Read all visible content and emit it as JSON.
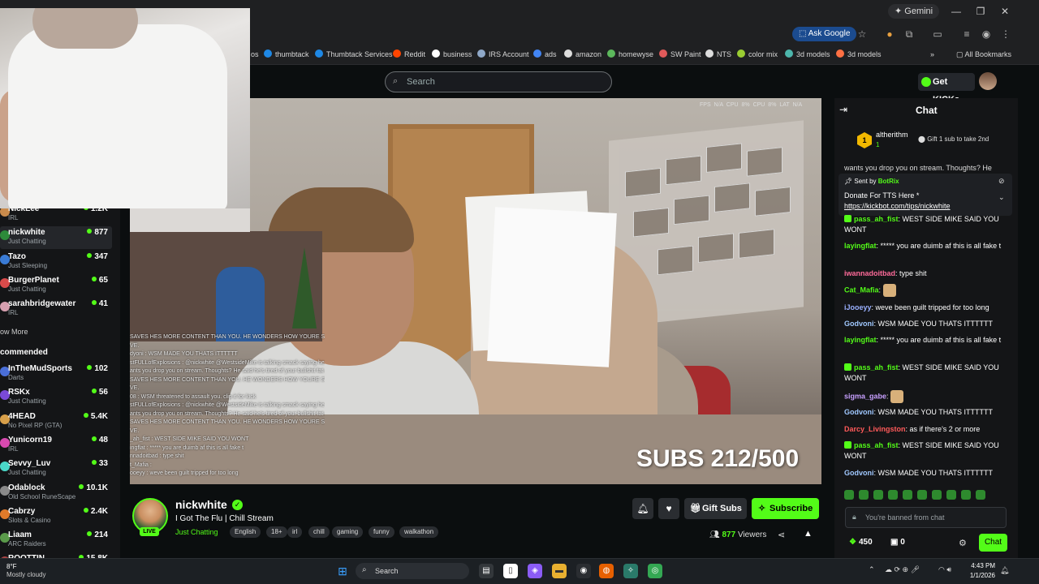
{
  "browser": {
    "gemini_label": "Gemini",
    "ask_google_label": "Ask Google",
    "all_bookmarks_label": "All Bookmarks",
    "bookmarks": [
      {
        "label": "thumbtack",
        "color": "#1e88e5"
      },
      {
        "label": "Thumbtack Services",
        "color": "#1e88e5"
      },
      {
        "label": "Reddit",
        "color": "#ff4500"
      },
      {
        "label": "business",
        "color": "#ffffff"
      },
      {
        "label": "IRS Account",
        "color": "#8fa8c8"
      },
      {
        "label": "ads",
        "color": "#4285f4"
      },
      {
        "label": "amazon",
        "color": "#dddddd"
      },
      {
        "label": "homewyse",
        "color": "#5cb85c"
      },
      {
        "label": "SW Paint",
        "color": "#e05a5a"
      },
      {
        "label": "NTS",
        "color": "#dddddd"
      },
      {
        "label": "color mix",
        "color": "#9acd32"
      },
      {
        "label": "3d models",
        "color": "#4db6ac"
      },
      {
        "label": "3d models",
        "color": "#ff7043"
      }
    ],
    "bookmark_partial": "os"
  },
  "kick": {
    "search_placeholder": "Search",
    "get_kicks_label": "Get KICKs",
    "brand_green": "#53fc18"
  },
  "sidebar": {
    "following": [
      {
        "name": "NickLee",
        "category": "IRL",
        "viewers": "1.2K",
        "color": "#c98b4c"
      },
      {
        "name": "nickwhite",
        "category": "Just Chatting",
        "viewers": "877",
        "color": "#2d8a3a"
      },
      {
        "name": "Tazo",
        "category": "Just Sleeping",
        "viewers": "347",
        "color": "#3a7bd5"
      },
      {
        "name": "BurgerPlanet",
        "category": "Just Chatting",
        "viewers": "65",
        "color": "#d84a4a"
      },
      {
        "name": "sarahbridgewater",
        "category": "IRL",
        "viewers": "41",
        "color": "#d6a0b0"
      }
    ],
    "show_more_label": "ow More",
    "recommended_label": "commended",
    "recommended": [
      {
        "name": "InTheMudSports",
        "category": "Darts",
        "viewers": "102",
        "color": "#4a6fd8"
      },
      {
        "name": "RSKx",
        "category": "Just Chatting",
        "viewers": "56",
        "color": "#7a4ad8"
      },
      {
        "name": "4HEAD",
        "category": "No Pixel RP (GTA)",
        "viewers": "5.4K",
        "color": "#d8a04a"
      },
      {
        "name": "Yunicorn19",
        "category": "IRL",
        "viewers": "48",
        "color": "#d84ab0"
      },
      {
        "name": "Sevvy_Luv",
        "category": "Just Chatting",
        "viewers": "33",
        "color": "#4ad8c8"
      },
      {
        "name": "Odablock",
        "category": "Old School RuneScape",
        "viewers": "10.1K",
        "color": "#8a8a8a"
      },
      {
        "name": "Cabrzy",
        "category": "Slots & Casino",
        "viewers": "2.4K",
        "color": "#e07a2a"
      },
      {
        "name": "Liaam",
        "category": "ARC Raiders",
        "viewers": "214",
        "color": "#5a9a4a"
      },
      {
        "name": "ROOTTIN",
        "category": "",
        "viewers": "15.8K",
        "color": "#aa4444"
      }
    ]
  },
  "video": {
    "subs_overlay": "SUBS 212/500",
    "stats_overlay": "FPS N/A   CPU 8%   CPU 8%   LAT N/A",
    "overlay_chat": [
      "SAVES HES MORE CONTENT THAN YOU. HE WONDERS HOW YOURE STILL",
      "VE.",
      "dyoni : WSM MADE YOU THATS ITTTTTT",
      "stFULLofExplosions : @nickwhite @WestsideMike is talking smack saying he",
      "ants you drop you on stream. Thoughts? He said he's tired of your bullshit fat ass",
      "SAVES HES MORE CONTENT THAN YOU. HE WONDERS HOW YOURE STILL",
      "VE.",
      "08 : WSM threatened to assault you. clip it for kick",
      "stFULLofExplosions : @nickwhite @WestsideMike is talking smack saying he",
      "ants you drop you on stream. Thoughts? He said he's tired of your bullshit fat ass",
      "SAVES HES MORE CONTENT THAN YOU. HE WONDERS HOW YOURE STILL",
      "VE.",
      "_ah_fist : WEST SIDE MIKE SAID YOU WONT",
      "ingflat : ***** you are duimb af this is all fake t",
      "nnadoitbad : type shit",
      "t_Mafia :",
      "ooeyy : weve been guilt tripped for too long"
    ]
  },
  "stream": {
    "streamer": "nickwhite",
    "live_label": "LIVE",
    "title": "I Got The Flu | Chill Stream",
    "category": "Just Chatting",
    "tags": [
      "English",
      "18+",
      "irl",
      "chill",
      "gaming",
      "funny",
      "walkathon"
    ],
    "gift_subs_label": "Gift Subs",
    "subscribe_label": "Subscribe",
    "viewers_count": "877",
    "viewers_label": "Viewers"
  },
  "chat": {
    "title": "Chat",
    "leader": {
      "rank": "1",
      "name": "altherithm",
      "amount": "1",
      "gift_text": "Gift 1 sub to take 2nd"
    },
    "cut_line": "wants you drop you on stream. Thoughts? He",
    "pinned": {
      "sent_by": "Sent by",
      "bot": "BotRix",
      "message": "Donate For TTS Here *",
      "link": "https://kickbot.com/tips/nickwhite"
    },
    "messages": [
      {
        "user": "pass_ah_fist",
        "color": "#53fc18",
        "badge": true,
        "text": "WEST SIDE MIKE SAID YOU WONT"
      },
      {
        "user": "layingflat",
        "color": "#53fc18",
        "badge": false,
        "text": "***** you are duimb af this is all fake t"
      },
      {
        "user": "iwannadoitbad",
        "color": "#ff6b9a",
        "badge": false,
        "text": "type shit"
      },
      {
        "user": "Cat_Mafia",
        "color": "#53fc18",
        "badge": false,
        "text": "",
        "emote": true
      },
      {
        "user": "iJooeyy",
        "color": "#9ab0ff",
        "badge": false,
        "text": "weve been guilt tripped for too long"
      },
      {
        "user": "Godvoni",
        "color": "#a0c8ff",
        "badge": false,
        "text": "WSM MADE YOU THATS ITTTTTT"
      },
      {
        "user": "layingflat",
        "color": "#53fc18",
        "badge": false,
        "text": "***** you are duimb af this is all fake t"
      },
      {
        "user": "pass_ah_fist",
        "color": "#53fc18",
        "badge": true,
        "text": "WEST SIDE MIKE SAID YOU WONT"
      },
      {
        "user": "sigma_gabe",
        "color": "#c8a0ff",
        "badge": false,
        "text": "",
        "emote": true
      },
      {
        "user": "Godvoni",
        "color": "#a0c8ff",
        "badge": false,
        "text": "WSM MADE YOU THATS ITTTTTT"
      },
      {
        "user": "Darcy_Livingston",
        "color": "#ff5a5a",
        "badge": false,
        "text": "as if there's 2 or more"
      },
      {
        "user": "pass_ah_fist",
        "color": "#53fc18",
        "badge": true,
        "text": "WEST SIDE MIKE SAID YOU WONT"
      },
      {
        "user": "Godvoni",
        "color": "#a0c8ff",
        "badge": false,
        "text": "WSM MADE YOU THATS ITTTTTT"
      }
    ],
    "banned_text": "You're banned from chat",
    "kicks_balance": "450",
    "store_count": "0",
    "chat_button": "Chat"
  },
  "taskbar": {
    "temp": "8°F",
    "weather": "Mostly cloudy",
    "search_label": "Search",
    "time": "4:43 PM",
    "date": "1/1/2026"
  }
}
